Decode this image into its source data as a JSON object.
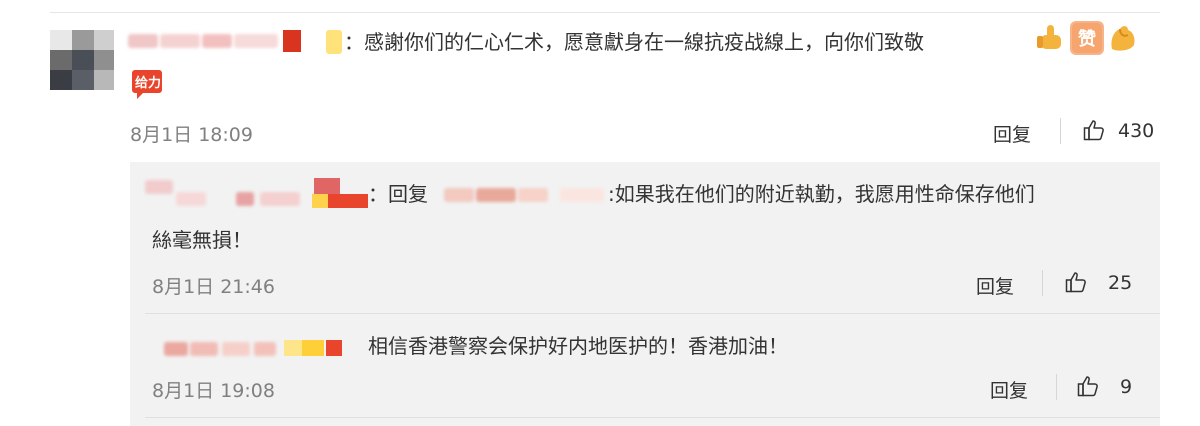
{
  "comment": {
    "text": "：感謝你们的仁心仁术，愿意獻身在一線抗疫战線上，向你们致敬",
    "badge_text": "给力",
    "time": "8月1日 18:09",
    "reply_label": "回复",
    "like_count": "430",
    "emojis": [
      "thumbs-up",
      "zan",
      "muscle"
    ]
  },
  "replies": [
    {
      "prefix": "：回复",
      "text_line1": ":如果我在他们的附近執勤，我愿用性命保存他们",
      "text_line2": "絲毫無損！",
      "time": "8月1日 21:46",
      "reply_label": "回复",
      "like_count": "25"
    },
    {
      "text": "相信香港警察会保护好内地医护的！香港加油！",
      "time": "8月1日 19:08",
      "reply_label": "回复",
      "like_count": "9"
    }
  ],
  "colors": {
    "badge_red": "#e8452c",
    "time_gray": "#808080",
    "reply_bg": "#f2f2f2"
  }
}
